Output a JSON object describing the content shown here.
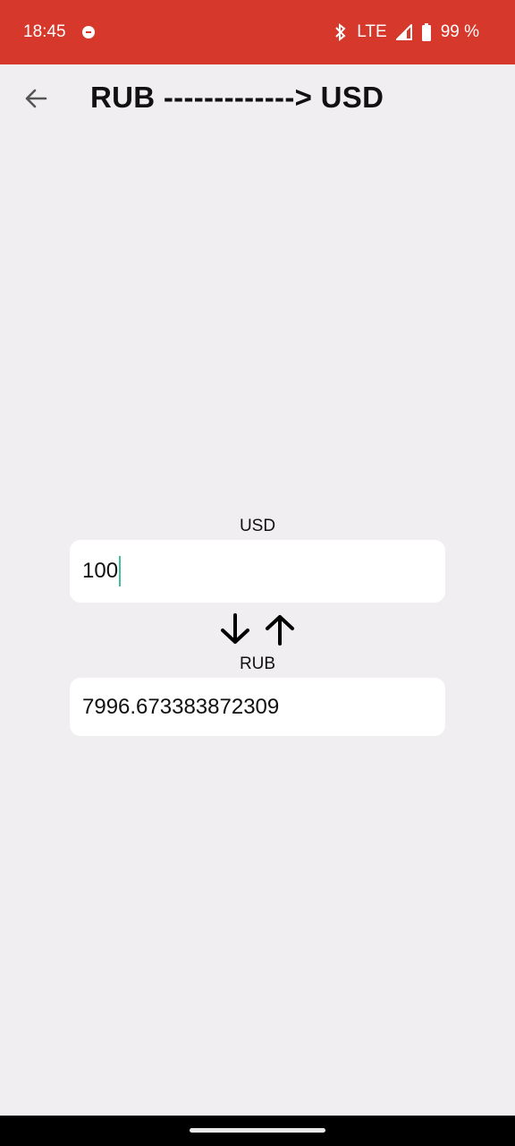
{
  "status_bar": {
    "time": "18:45",
    "network": "LTE",
    "battery": "99 %",
    "icons": [
      "notification-icon",
      "bluetooth-icon",
      "signal-icon",
      "battery-icon"
    ],
    "color": "#d7382c"
  },
  "toolbar": {
    "back_icon": "arrow-left-icon",
    "title": "RUB -------------> USD"
  },
  "converter": {
    "top_label": "USD",
    "top_value": "100",
    "swap_icons": [
      "arrow-down-icon",
      "arrow-up-icon"
    ],
    "bottom_label": "RUB",
    "bottom_value": "7996.673383872309",
    "caret_color": "#3fbf9f"
  }
}
